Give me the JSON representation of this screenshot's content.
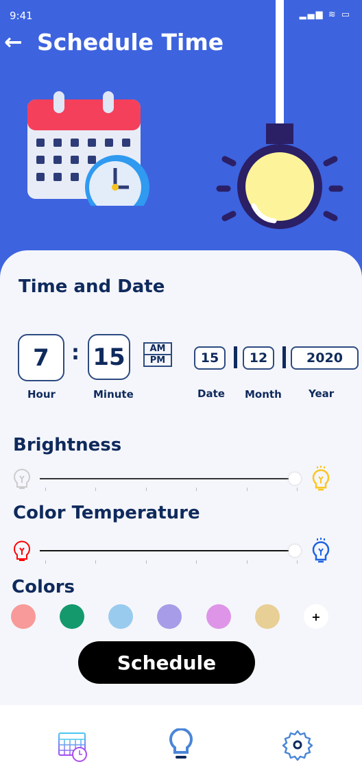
{
  "status": {
    "time": "9:41",
    "icons": "▂▄▆ ≋ ▭"
  },
  "header": {
    "back": "←",
    "title": "Schedule Time"
  },
  "section": {
    "title": "Time and Date"
  },
  "time": {
    "hour": "7",
    "minute": "15",
    "sep": ":",
    "am": "AM",
    "pm": "PM",
    "hour_label": "Hour",
    "minute_label": "Minute"
  },
  "date": {
    "day": "15",
    "month": "12",
    "year": "2020",
    "day_label": "Date",
    "month_label": "Month",
    "year_label": "Year"
  },
  "brightness": {
    "title": "Brightness",
    "value": 1.0
  },
  "temperature": {
    "title": "Color Temperature",
    "value": 1.0
  },
  "colors": {
    "title": "Colors",
    "swatches": [
      "#f79a99",
      "#14996d",
      "#99cbee",
      "#a79ce7",
      "#de95e8",
      "#e8cf95"
    ],
    "add": "+"
  },
  "schedule_button": "Schedule"
}
